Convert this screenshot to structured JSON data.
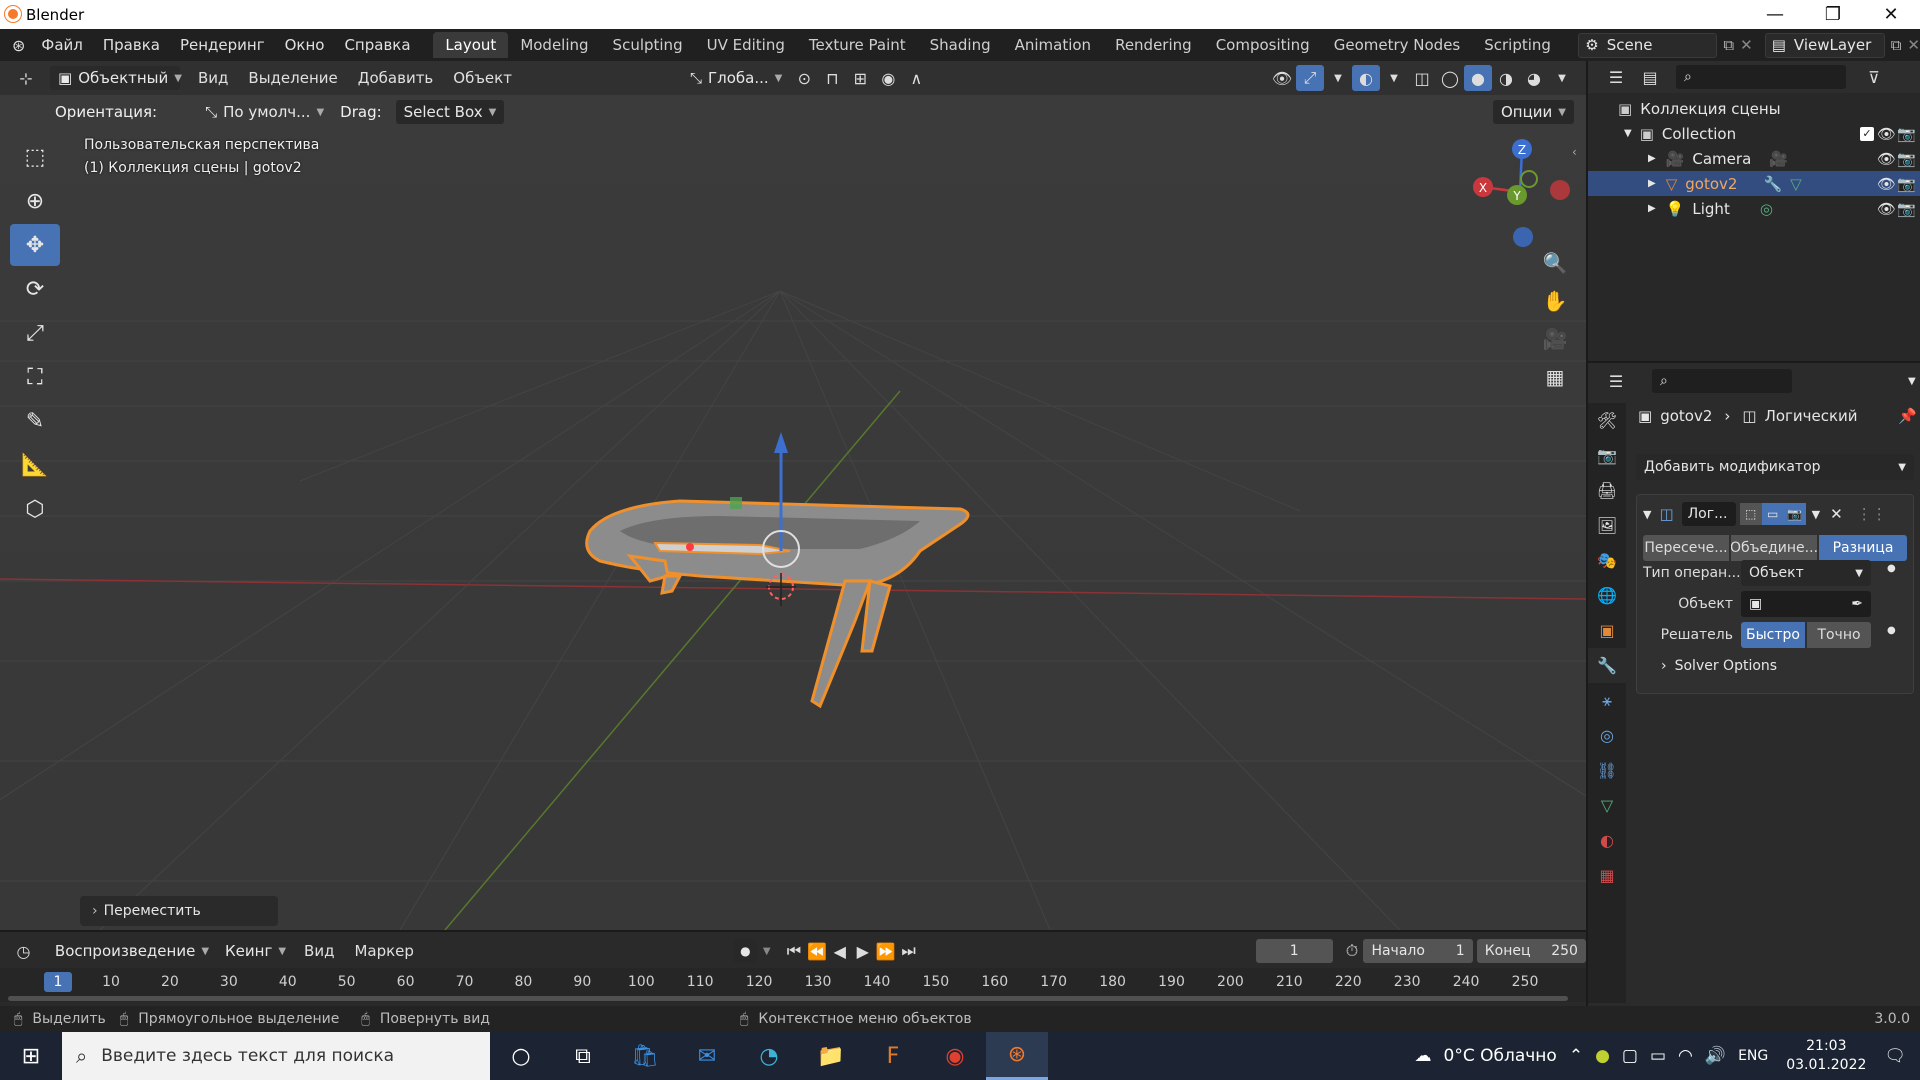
{
  "window": {
    "title": "Blender"
  },
  "menu": [
    "Файл",
    "Правка",
    "Рендеринг",
    "Окно",
    "Справка"
  ],
  "workspaces": [
    {
      "label": "Layout",
      "active": true
    },
    {
      "label": "Modeling"
    },
    {
      "label": "Sculpting"
    },
    {
      "label": "UV Editing"
    },
    {
      "label": "Texture Paint"
    },
    {
      "label": "Shading"
    },
    {
      "label": "Animation"
    },
    {
      "label": "Rendering"
    },
    {
      "label": "Compositing"
    },
    {
      "label": "Geometry Nodes"
    },
    {
      "label": "Scripting"
    }
  ],
  "scene": {
    "name": "Scene",
    "viewlayer": "ViewLayer"
  },
  "viewport_header": {
    "mode": "Объектный",
    "menus": [
      "Вид",
      "Выделение",
      "Добавить",
      "Объект"
    ],
    "transform_orientation": "Глоба..."
  },
  "tool_options": {
    "orientation_label": "Ориентация:",
    "orientation_value": "По умолч...",
    "drag_label": "Drag:",
    "drag_value": "Select Box",
    "options_label": "Опции"
  },
  "viewport": {
    "view_name": "Пользовательская перспектива",
    "collection_info": "(1) Коллекция сцены | gotov2",
    "last_op": "Переместить",
    "gizmo": {
      "x": "X",
      "y": "Y",
      "z": "Z"
    }
  },
  "outliner": {
    "root": "Коллекция сцены",
    "collection": "Collection",
    "items": [
      {
        "name": "Camera",
        "selected": false
      },
      {
        "name": "gotov2",
        "selected": true
      },
      {
        "name": "Light",
        "selected": false
      }
    ]
  },
  "properties": {
    "breadcrumb_object": "gotov2",
    "breadcrumb_modifier": "Логический",
    "add_modifier": "Добавить модификатор",
    "modifier_name": "Лог...",
    "operations": [
      {
        "label": "Пересече...",
        "on": false
      },
      {
        "label": "Объедине...",
        "on": false
      },
      {
        "label": "Разница",
        "on": true
      }
    ],
    "operand_label": "Тип операн...",
    "operand_value": "Объект",
    "object_label": "Объект",
    "solver_label": "Решатель",
    "solver_fast": "Быстро",
    "solver_exact": "Точно",
    "solver_options": "Solver Options"
  },
  "timeline": {
    "menus": [
      "Воспроизведение",
      "Кеинг",
      "Вид",
      "Маркер"
    ],
    "current_frame": "1",
    "start_label": "Начало",
    "start_value": "1",
    "end_label": "Конец",
    "end_value": "250",
    "ruler": [
      "1",
      "10",
      "20",
      "30",
      "40",
      "50",
      "60",
      "70",
      "80",
      "90",
      "100",
      "110",
      "120",
      "130",
      "140",
      "150",
      "160",
      "170",
      "180",
      "190",
      "200",
      "210",
      "220",
      "230",
      "240",
      "250"
    ]
  },
  "status": {
    "select": "Выделить",
    "box_select": "Прямоугольное выделение",
    "rotate_view": "Повернуть вид",
    "context_menu": "Контекстное меню объектов",
    "version": "3.0.0"
  },
  "taskbar": {
    "search_placeholder": "Введите здесь текст для поиска",
    "weather": "0°C Облачно",
    "lang": "ENG",
    "time": "21:03",
    "date": "03.01.2022"
  },
  "colors": {
    "accent": "#4772b3",
    "selection_outline": "#f0902c",
    "x_axis": "#c8383c",
    "y_axis": "#6a9a2e",
    "z_axis": "#3c6fcf"
  }
}
